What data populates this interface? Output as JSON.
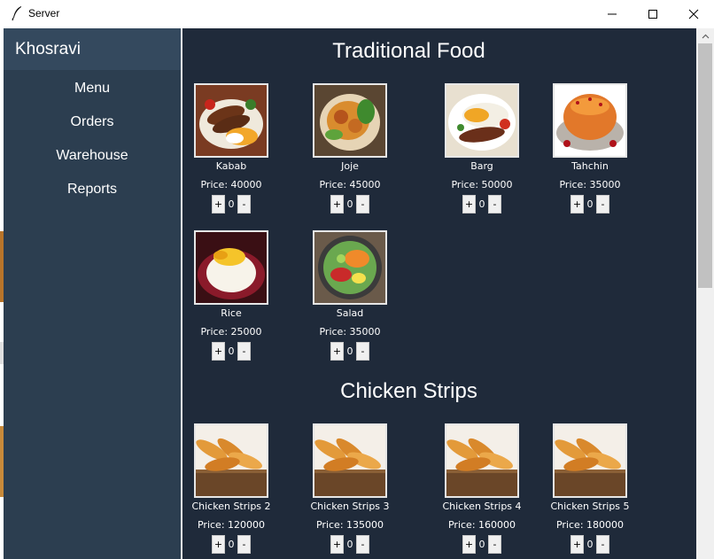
{
  "window": {
    "title": "Server"
  },
  "sidebar": {
    "header": "Khosravi",
    "items": [
      {
        "label": "Menu"
      },
      {
        "label": "Orders"
      },
      {
        "label": "Warehouse"
      },
      {
        "label": "Reports"
      }
    ]
  },
  "sections": [
    {
      "title": "Traditional Food",
      "items": [
        {
          "name": "Kabab",
          "price": "Price: 40000",
          "qty": "0",
          "plus": "+",
          "minus": "-"
        },
        {
          "name": "Joje",
          "price": "Price: 45000",
          "qty": "0",
          "plus": "+",
          "minus": "-"
        },
        {
          "name": "Barg",
          "price": "Price: 50000",
          "qty": "0",
          "plus": "+",
          "minus": "-"
        },
        {
          "name": "Tahchin",
          "price": "Price: 35000",
          "qty": "0",
          "plus": "+",
          "minus": "-"
        },
        {
          "name": "Rice",
          "price": "Price: 25000",
          "qty": "0",
          "plus": "+",
          "minus": "-"
        },
        {
          "name": "Salad",
          "price": "Price: 35000",
          "qty": "0",
          "plus": "+",
          "minus": "-"
        }
      ]
    },
    {
      "title": "Chicken Strips",
      "items": [
        {
          "name": "Chicken Strips 2",
          "price": "Price: 120000",
          "qty": "0",
          "plus": "+",
          "minus": "-"
        },
        {
          "name": "Chicken Strips 3",
          "price": "Price: 135000",
          "qty": "0",
          "plus": "+",
          "minus": "-"
        },
        {
          "name": "Chicken Strips 4",
          "price": "Price: 160000",
          "qty": "0",
          "plus": "+",
          "minus": "-"
        },
        {
          "name": "Chicken Strips 5",
          "price": "Price: 180000",
          "qty": "0",
          "plus": "+",
          "minus": "-"
        }
      ]
    }
  ],
  "icons": {
    "app": "feather-icon",
    "minimize": "minimize-icon",
    "maximize": "maximize-icon",
    "close": "close-icon"
  },
  "colors": {
    "sidebar_bg": "#2c3e50",
    "sidebar_header_bg": "#34495e",
    "main_bg": "#1f2a3a",
    "text": "#ffffff"
  }
}
